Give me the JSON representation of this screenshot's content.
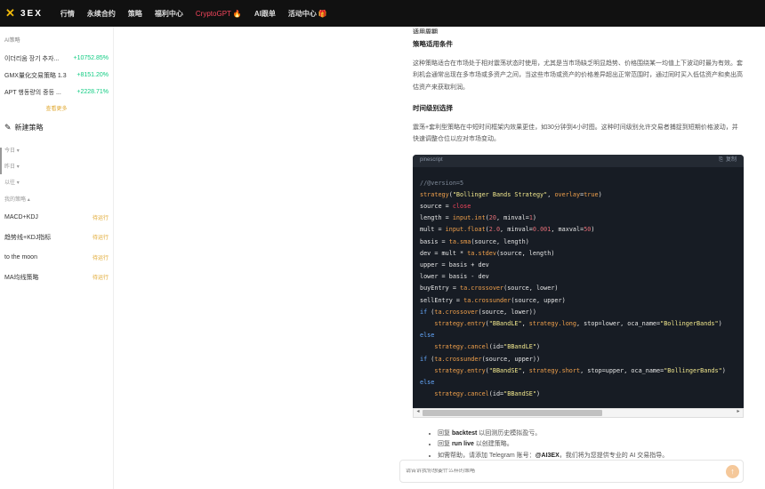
{
  "nav": {
    "logo_text": "3EX",
    "items": [
      "行情",
      "永续合约",
      "策略",
      "福利中心",
      "CryptoGPT",
      "AI跟单",
      "活动中心"
    ]
  },
  "sidebar": {
    "ai_strategy_heading": "AI策略",
    "top_strategies": [
      {
        "name": "이더리움 장기 추자...",
        "pct": "+10752.85%"
      },
      {
        "name": "GMX量化交易策略 1.3",
        "pct": "+8151.20%"
      },
      {
        "name": "APT 행동량의 중등 ...",
        "pct": "+2228.71%"
      }
    ],
    "view_more": "查看更多",
    "new_strategy": "新建策略",
    "date_groups": [
      "今日",
      "昨日",
      "以往"
    ],
    "my_strategies_heading": "我的策略",
    "my_strategies": [
      {
        "name": "MACD+KDJ",
        "status": "待运行"
      },
      {
        "name": "趋势线+KDJ指标",
        "status": "待运行"
      },
      {
        "name": "to the moon",
        "status": "待运行"
      },
      {
        "name": "MA均线策略",
        "status": "待运行"
      }
    ]
  },
  "content": {
    "top_cut": "适用周期",
    "section1_title": "策略适用条件",
    "section1_text": "这种策略适合在市场处于相对震荡状态时使用，尤其是当市场缺乏明显趋势、价格围绕某一均值上下波动时最为有效。套利机会通常出现在多市场或多资产之间，当这些市场或资产的价格差异超出正常范围时，通过同时买入低估资产和卖出高估资产来获取利润。",
    "section2_title": "时间级别选择",
    "section2_text": "震荡+套利型策略在中短时间框架内效果更佳，如30分钟到4小时图。这种时间级别允许交易者捕捉到短期价格波动，并快速调整仓位以应对市场变动。",
    "code_lang": "pinescript",
    "copy_label": "复制",
    "bullets": [
      {
        "pre": "回复 ",
        "bold": "backtest",
        "post": " 以回测历史模拟盈亏。"
      },
      {
        "pre": "回复 ",
        "bold": "run live",
        "post": " 以创建策略。"
      },
      {
        "pre": "如需帮助，请添加 Telegram 账号：",
        "bold": "@AI3EX",
        "post": "，我们将为您提供专业的 AI 交易指导。"
      }
    ]
  },
  "input": {
    "placeholder": "请告诉我你想要什么样的策略"
  }
}
